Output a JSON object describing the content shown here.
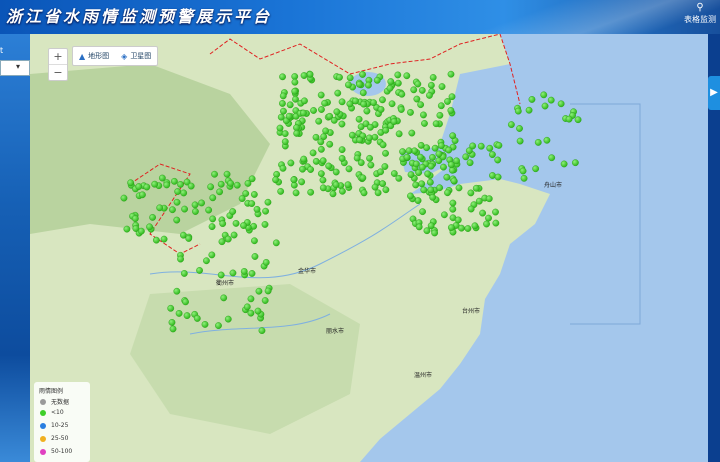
{
  "header": {
    "title": "浙江省水雨情监测预警展示平台",
    "table_btn": "表格监测"
  },
  "left_rail": {
    "label": "t"
  },
  "map_controls": {
    "zoom_in": "+",
    "zoom_out": "−",
    "terrain": "地形图",
    "satellite": "卫星图"
  },
  "legend": {
    "title": "雨情图例",
    "items": [
      {
        "label": "无数据",
        "color": "#9a9a9a"
      },
      {
        "label": "<10",
        "color": "#3fcf2a"
      },
      {
        "label": "10-25",
        "color": "#2a7fe0"
      },
      {
        "label": "25-50",
        "color": "#f0b020"
      },
      {
        "label": "50-100",
        "color": "#e040c0"
      }
    ]
  },
  "cities": [
    "金华市",
    "丽水市",
    "台州市",
    "温州市",
    "舟山市",
    "衢州市"
  ],
  "colors": {
    "station": "#43cc2c",
    "land": "#d8e6c0",
    "hills": "#b9d39f",
    "sea": "#a4c7ec",
    "border": "#e02020"
  }
}
